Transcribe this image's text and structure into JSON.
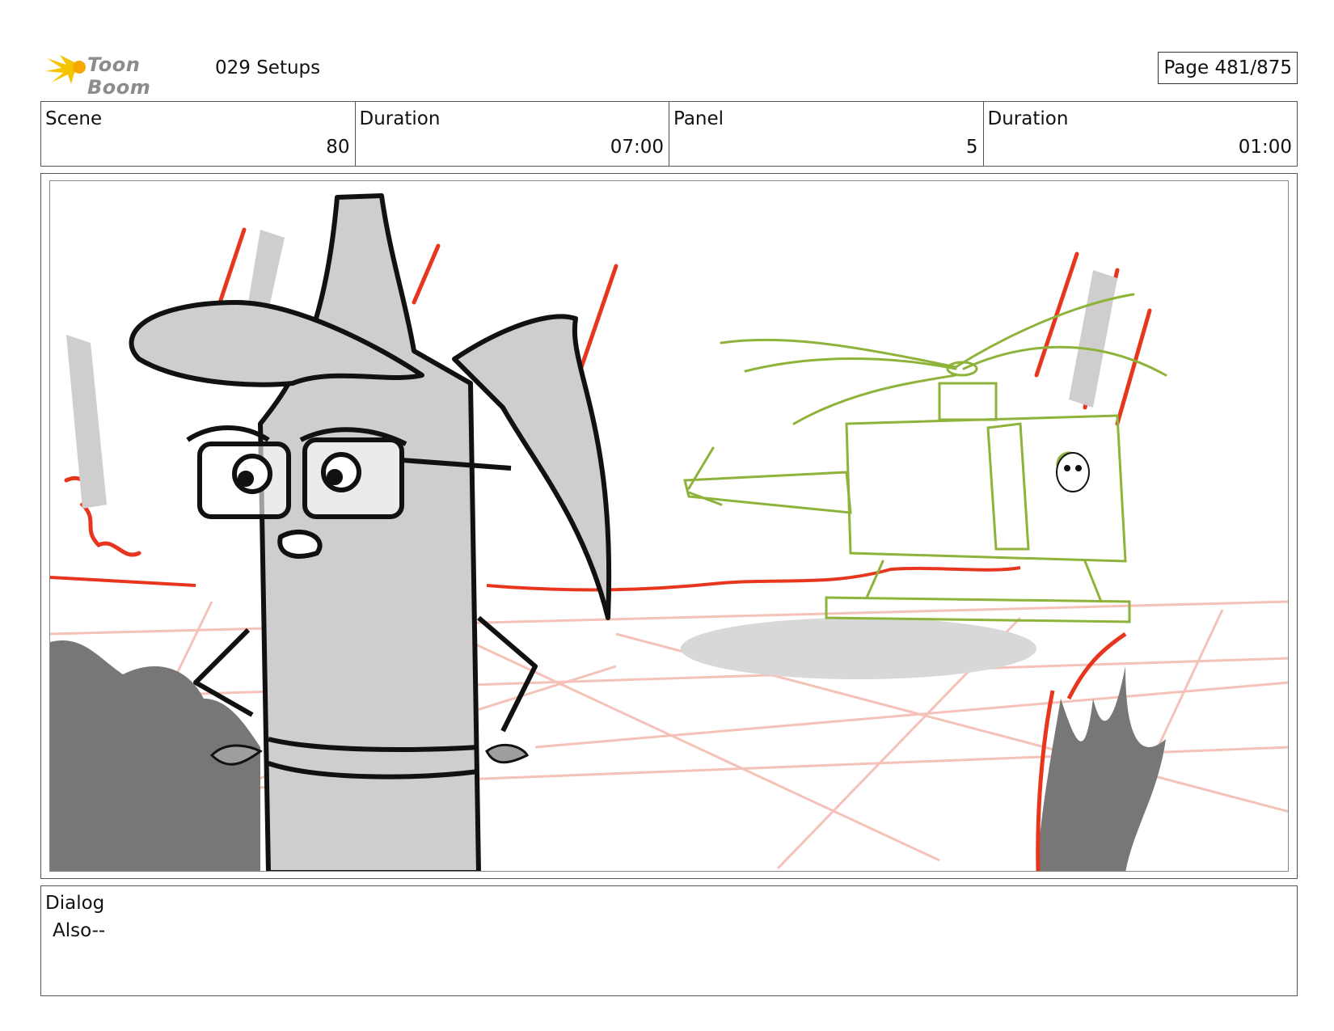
{
  "header": {
    "logo_text": "Toon Boom",
    "project_title": "029 Setups",
    "page_label": "Page 481/875"
  },
  "info": {
    "scene_label": "Scene",
    "scene_value": "80",
    "scene_duration_label": "Duration",
    "scene_duration_value": "07:00",
    "panel_label": "Panel",
    "panel_value": "5",
    "panel_duration_label": "Duration",
    "panel_duration_value": "01:00"
  },
  "dialog": {
    "label": "Dialog",
    "text": "Also--"
  },
  "colors": {
    "red_line": "#e8361e",
    "green_line": "#8db33a",
    "gray_fill": "#cfcdcd",
    "dark_gray": "#767676",
    "logo_yellow": "#f5c400"
  }
}
